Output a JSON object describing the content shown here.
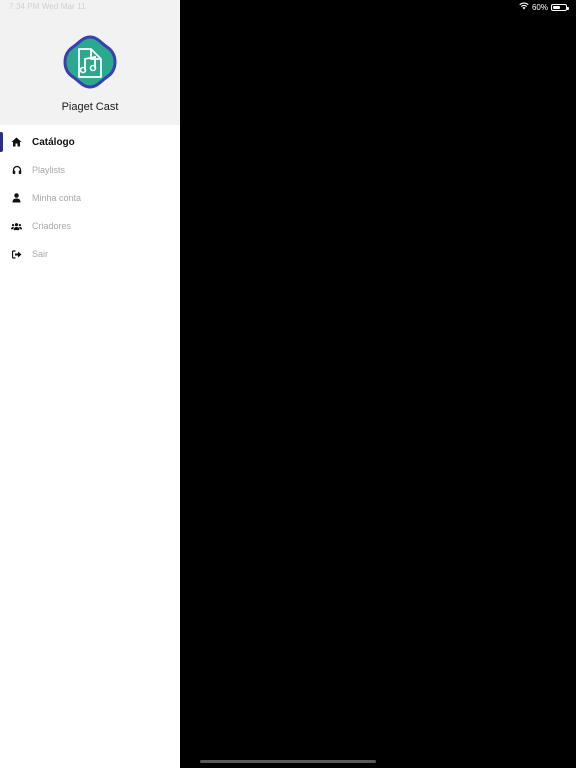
{
  "status_bar": {
    "time": "7:34 PM  Wed Mar 11",
    "battery": "60%",
    "battery_level": 0.6
  },
  "drawer": {
    "app_name": "Piaget Cast",
    "logo_icon": "music-notes-shield-icon",
    "menu": [
      {
        "label": "Catálogo",
        "icon": "home-icon",
        "active": true
      },
      {
        "label": "Playlists",
        "icon": "headphones-icon",
        "active": false
      },
      {
        "label": "Minha conta",
        "icon": "user-icon",
        "active": false
      },
      {
        "label": "Criadores",
        "icon": "users-icon",
        "active": false
      },
      {
        "label": "Sair",
        "icon": "sign-out-icon",
        "active": false
      }
    ]
  },
  "colors": {
    "accent": "#2a2f8c",
    "logo_fill": "#2aa98f",
    "logo_border": "#3b3fb0",
    "header_bg": "#f2f2f2"
  }
}
